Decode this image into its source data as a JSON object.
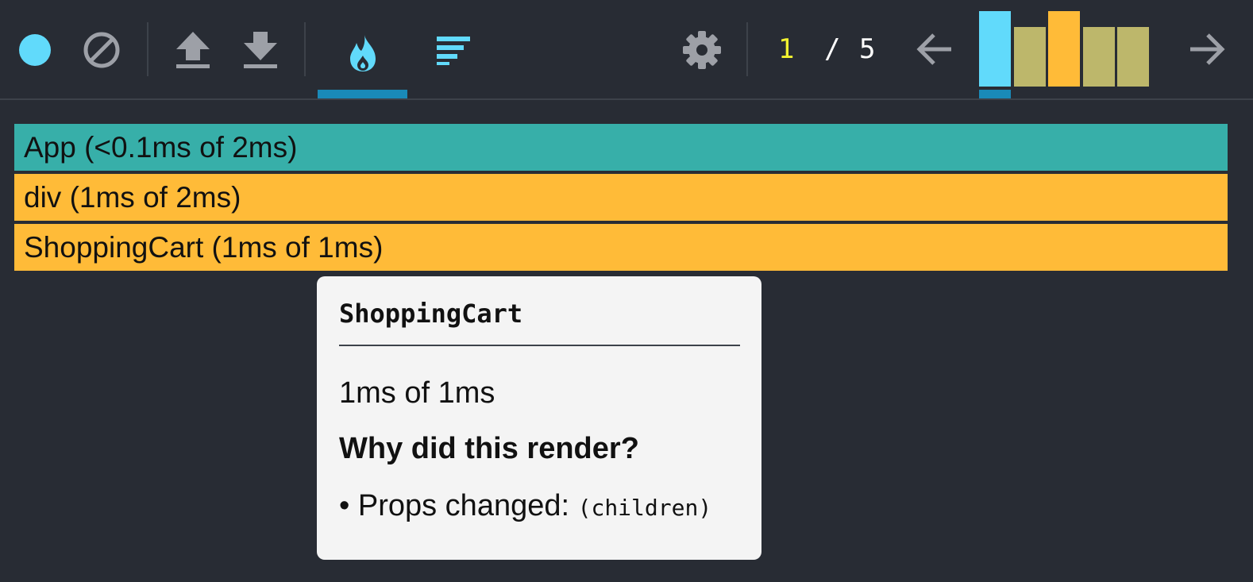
{
  "toolbar": {
    "icons": [
      "record-icon",
      "clear-icon",
      "upload-icon",
      "download-icon",
      "flame-chart-icon",
      "ranked-chart-icon",
      "settings-icon",
      "previous-commit-icon",
      "next-commit-icon"
    ],
    "active_tab": "flame-chart",
    "colors": {
      "accent": "#61dafb",
      "icon_gray": "#9da0a7",
      "tab_underline": "#1a8ab8"
    }
  },
  "commits": {
    "current": "1",
    "separator": "/",
    "total": "5",
    "bars": [
      {
        "relative_duration": 1.0,
        "color": "#61dafb",
        "selected": true
      },
      {
        "relative_duration": 0.79,
        "color": "#bdb76b",
        "selected": false
      },
      {
        "relative_duration": 1.0,
        "color": "#ffbb38",
        "selected": false
      },
      {
        "relative_duration": 0.79,
        "color": "#bdb76b",
        "selected": false
      },
      {
        "relative_duration": 0.79,
        "color": "#bdb76b",
        "selected": false
      }
    ]
  },
  "flamegraph": {
    "rows": [
      {
        "label": "App (<0.1ms of 2ms)",
        "color": "#37afa9"
      },
      {
        "label": "div (1ms of 2ms)",
        "color": "#ffbb38"
      },
      {
        "label": "ShoppingCart (1ms of 1ms)",
        "color": "#ffbb38"
      }
    ]
  },
  "tooltip": {
    "title": "ShoppingCart",
    "duration": "1ms of 1ms",
    "why_heading": "Why did this render?",
    "reason_prefix": "• Props changed:",
    "reason_props": "(children)"
  }
}
